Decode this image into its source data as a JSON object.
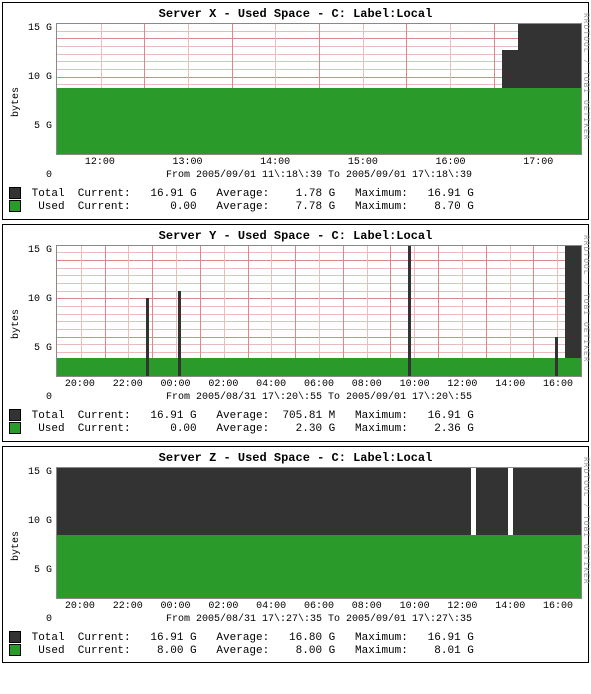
{
  "side_credit": "RRDTOOL / TOBI OETIKER",
  "chart_data": [
    {
      "id": "x",
      "server": "Server X",
      "title_suffix": " - Used Space - C: Label:Local",
      "ylabel": "bytes",
      "ylim": [
        0,
        17
      ],
      "yticks": [
        "15 G",
        "10 G",
        "5 G",
        "0"
      ],
      "xticks": [
        "12:00",
        "13:00",
        "14:00",
        "15:00",
        "16:00",
        "17:00"
      ],
      "caption": "From 2005/09/01 11\\:18\\:39 To 2005/09/01 17\\:18\\:39",
      "used_height_pct": 51,
      "total_blocks": [
        {
          "left_pct": 88,
          "right_pct": 100,
          "height_pct": 100
        },
        {
          "left_pct": 85,
          "right_pct": 88,
          "height_pct": 80
        }
      ],
      "spikes": [],
      "legend": {
        "total": {
          "current": "16.91 G",
          "average": "1.78 G",
          "maximum": "16.91 G"
        },
        "used": {
          "current": "0.00",
          "average": "7.78 G",
          "maximum": "8.70 G"
        }
      }
    },
    {
      "id": "y",
      "server": "Server Y",
      "title_suffix": " - Used Space - C: Label:Local",
      "ylabel": "bytes",
      "ylim": [
        0,
        17
      ],
      "yticks": [
        "15 G",
        "10 G",
        "5 G",
        "0"
      ],
      "xticks": [
        "20:00",
        "22:00",
        "00:00",
        "02:00",
        "04:00",
        "06:00",
        "08:00",
        "10:00",
        "12:00",
        "14:00",
        "16:00"
      ],
      "caption": "From 2005/08/31 17\\:20\\:55 To 2005/09/01 17\\:20\\:55",
      "used_height_pct": 14,
      "total_blocks": [
        {
          "left_pct": 97,
          "right_pct": 100,
          "height_pct": 100
        }
      ],
      "spikes": [
        {
          "x_pct": 17,
          "h_pct": 60
        },
        {
          "x_pct": 23,
          "h_pct": 65
        },
        {
          "x_pct": 67,
          "h_pct": 100
        },
        {
          "x_pct": 95,
          "h_pct": 30
        }
      ],
      "legend": {
        "total": {
          "current": "16.91 G",
          "average": "705.81 M",
          "maximum": "16.91 G"
        },
        "used": {
          "current": "0.00",
          "average": "2.30 G",
          "maximum": "2.36 G"
        }
      }
    },
    {
      "id": "z",
      "server": "Server Z",
      "title_suffix": " - Used Space - C: Label:Local",
      "ylabel": "bytes",
      "ylim": [
        0,
        17
      ],
      "yticks": [
        "15 G",
        "10 G",
        "5 G",
        "0"
      ],
      "xticks": [
        "20:00",
        "22:00",
        "00:00",
        "02:00",
        "04:00",
        "06:00",
        "08:00",
        "10:00",
        "12:00",
        "14:00",
        "16:00"
      ],
      "caption": "From 2005/08/31 17\\:27\\:35 To 2005/09/01 17\\:27\\:35",
      "used_height_pct": 48,
      "total_blocks": [
        {
          "left_pct": 0,
          "right_pct": 100,
          "height_pct": 100
        }
      ],
      "spikes": [],
      "gaps": [
        {
          "x_pct": 79,
          "w_pct": 1
        },
        {
          "x_pct": 86,
          "w_pct": 1
        }
      ],
      "legend": {
        "total": {
          "current": "16.91 G",
          "average": "16.80 G",
          "maximum": "16.91 G"
        },
        "used": {
          "current": "8.00 G",
          "average": "8.00 G",
          "maximum": "8.01 G"
        }
      }
    }
  ],
  "legend_labels": {
    "total": "Total",
    "used": "Used",
    "current": "Current:",
    "average": "Average:",
    "maximum": "Maximum:"
  }
}
